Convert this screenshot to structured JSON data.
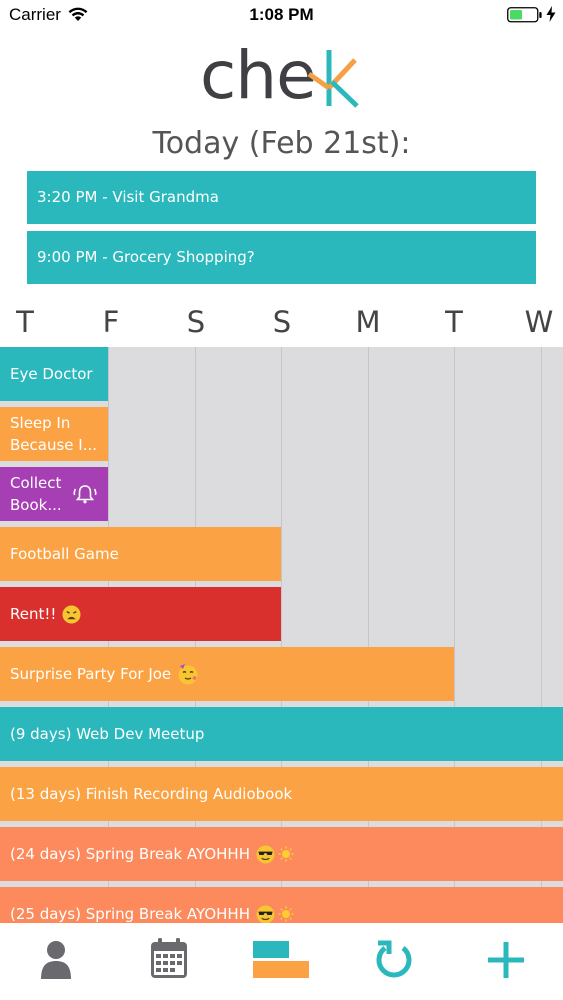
{
  "status_bar": {
    "carrier": "Carrier",
    "time": "1:08 PM",
    "battery_color": "#4cd964"
  },
  "logo": {
    "text": "chek",
    "accent_color": "#f5a042",
    "accent2_color": "#2ab8bd"
  },
  "today": {
    "title": "Today (Feb 21st):",
    "events": [
      {
        "label": "3:20 PM - Visit Grandma"
      },
      {
        "label": "9:00 PM - Grocery Shopping?"
      }
    ]
  },
  "days": [
    "T",
    "F",
    "S",
    "S",
    "M",
    "T",
    "W"
  ],
  "colors": {
    "teal": "#2ab8bd",
    "orange": "#fba344",
    "purple": "#a63fb3",
    "red": "#d9302d",
    "coral": "#fc8a5c",
    "grid_bg": "#dcdcdf"
  },
  "events": [
    {
      "label": "Eye Doctor",
      "color": "teal",
      "days_span": 1
    },
    {
      "label": "Sleep In Because I...",
      "color": "orange",
      "days_span": 1
    },
    {
      "label": "Collect Book...",
      "color": "purple",
      "days_span": 1,
      "icon": "alarm-bell-icon"
    },
    {
      "label": "Football Game",
      "color": "orange",
      "days_span": 3
    },
    {
      "label": "Rent!!",
      "color": "red",
      "days_span": 3,
      "icon": "weary-face-emoji"
    },
    {
      "label": "Surprise Party For Joe",
      "color": "orange",
      "days_span": 5,
      "icon": "party-face-emoji"
    },
    {
      "label": "(9 days) Web Dev Meetup",
      "color": "teal",
      "days_span": 7
    },
    {
      "label": "(13 days) Finish Recording Audiobook",
      "color": "orange",
      "days_span": 7
    },
    {
      "label": "(24 days) Spring Break AYOHHH",
      "color": "coral",
      "days_span": 7,
      "icon": "sunglasses-sun-emoji"
    },
    {
      "label": "(25 days) Spring Break AYOHHH",
      "color": "coral",
      "days_span": 7,
      "icon": "sunglasses-sun-emoji"
    }
  ],
  "tab_bar": {
    "tabs": [
      {
        "name": "profile",
        "icon": "person-icon",
        "color": "#666666"
      },
      {
        "name": "calendar",
        "icon": "calendar-icon",
        "color": "#666666"
      },
      {
        "name": "timeline",
        "icon": "timeline-icon",
        "active": true
      },
      {
        "name": "refresh",
        "icon": "refresh-icon",
        "color": "#2ab8bd"
      },
      {
        "name": "add",
        "icon": "plus-icon",
        "color": "#2ab8bd"
      }
    ]
  }
}
